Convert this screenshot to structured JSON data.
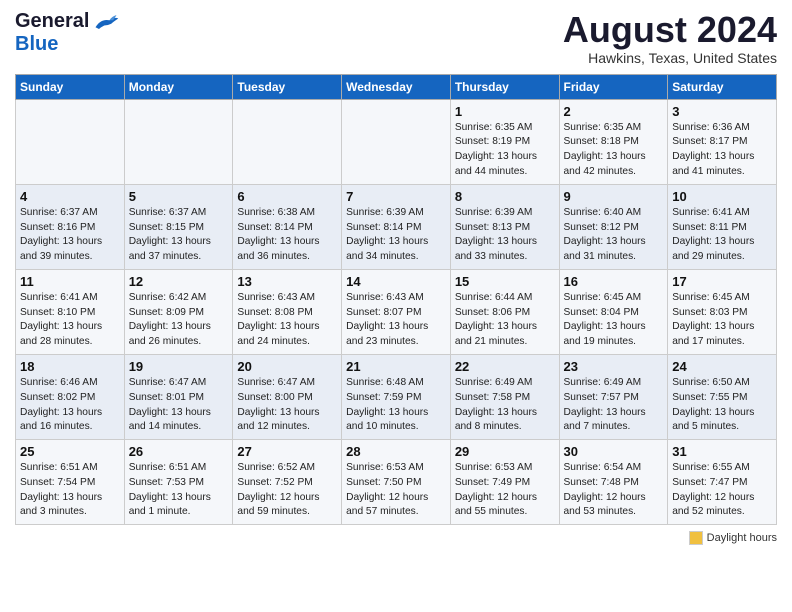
{
  "header": {
    "logo_general": "General",
    "logo_blue": "Blue",
    "month_year": "August 2024",
    "location": "Hawkins, Texas, United States"
  },
  "weekdays": [
    "Sunday",
    "Monday",
    "Tuesday",
    "Wednesday",
    "Thursday",
    "Friday",
    "Saturday"
  ],
  "weeks": [
    [
      {
        "day": "",
        "info": ""
      },
      {
        "day": "",
        "info": ""
      },
      {
        "day": "",
        "info": ""
      },
      {
        "day": "",
        "info": ""
      },
      {
        "day": "1",
        "info": "Sunrise: 6:35 AM\nSunset: 8:19 PM\nDaylight: 13 hours\nand 44 minutes."
      },
      {
        "day": "2",
        "info": "Sunrise: 6:35 AM\nSunset: 8:18 PM\nDaylight: 13 hours\nand 42 minutes."
      },
      {
        "day": "3",
        "info": "Sunrise: 6:36 AM\nSunset: 8:17 PM\nDaylight: 13 hours\nand 41 minutes."
      }
    ],
    [
      {
        "day": "4",
        "info": "Sunrise: 6:37 AM\nSunset: 8:16 PM\nDaylight: 13 hours\nand 39 minutes."
      },
      {
        "day": "5",
        "info": "Sunrise: 6:37 AM\nSunset: 8:15 PM\nDaylight: 13 hours\nand 37 minutes."
      },
      {
        "day": "6",
        "info": "Sunrise: 6:38 AM\nSunset: 8:14 PM\nDaylight: 13 hours\nand 36 minutes."
      },
      {
        "day": "7",
        "info": "Sunrise: 6:39 AM\nSunset: 8:14 PM\nDaylight: 13 hours\nand 34 minutes."
      },
      {
        "day": "8",
        "info": "Sunrise: 6:39 AM\nSunset: 8:13 PM\nDaylight: 13 hours\nand 33 minutes."
      },
      {
        "day": "9",
        "info": "Sunrise: 6:40 AM\nSunset: 8:12 PM\nDaylight: 13 hours\nand 31 minutes."
      },
      {
        "day": "10",
        "info": "Sunrise: 6:41 AM\nSunset: 8:11 PM\nDaylight: 13 hours\nand 29 minutes."
      }
    ],
    [
      {
        "day": "11",
        "info": "Sunrise: 6:41 AM\nSunset: 8:10 PM\nDaylight: 13 hours\nand 28 minutes."
      },
      {
        "day": "12",
        "info": "Sunrise: 6:42 AM\nSunset: 8:09 PM\nDaylight: 13 hours\nand 26 minutes."
      },
      {
        "day": "13",
        "info": "Sunrise: 6:43 AM\nSunset: 8:08 PM\nDaylight: 13 hours\nand 24 minutes."
      },
      {
        "day": "14",
        "info": "Sunrise: 6:43 AM\nSunset: 8:07 PM\nDaylight: 13 hours\nand 23 minutes."
      },
      {
        "day": "15",
        "info": "Sunrise: 6:44 AM\nSunset: 8:06 PM\nDaylight: 13 hours\nand 21 minutes."
      },
      {
        "day": "16",
        "info": "Sunrise: 6:45 AM\nSunset: 8:04 PM\nDaylight: 13 hours\nand 19 minutes."
      },
      {
        "day": "17",
        "info": "Sunrise: 6:45 AM\nSunset: 8:03 PM\nDaylight: 13 hours\nand 17 minutes."
      }
    ],
    [
      {
        "day": "18",
        "info": "Sunrise: 6:46 AM\nSunset: 8:02 PM\nDaylight: 13 hours\nand 16 minutes."
      },
      {
        "day": "19",
        "info": "Sunrise: 6:47 AM\nSunset: 8:01 PM\nDaylight: 13 hours\nand 14 minutes."
      },
      {
        "day": "20",
        "info": "Sunrise: 6:47 AM\nSunset: 8:00 PM\nDaylight: 13 hours\nand 12 minutes."
      },
      {
        "day": "21",
        "info": "Sunrise: 6:48 AM\nSunset: 7:59 PM\nDaylight: 13 hours\nand 10 minutes."
      },
      {
        "day": "22",
        "info": "Sunrise: 6:49 AM\nSunset: 7:58 PM\nDaylight: 13 hours\nand 8 minutes."
      },
      {
        "day": "23",
        "info": "Sunrise: 6:49 AM\nSunset: 7:57 PM\nDaylight: 13 hours\nand 7 minutes."
      },
      {
        "day": "24",
        "info": "Sunrise: 6:50 AM\nSunset: 7:55 PM\nDaylight: 13 hours\nand 5 minutes."
      }
    ],
    [
      {
        "day": "25",
        "info": "Sunrise: 6:51 AM\nSunset: 7:54 PM\nDaylight: 13 hours\nand 3 minutes."
      },
      {
        "day": "26",
        "info": "Sunrise: 6:51 AM\nSunset: 7:53 PM\nDaylight: 13 hours\nand 1 minute."
      },
      {
        "day": "27",
        "info": "Sunrise: 6:52 AM\nSunset: 7:52 PM\nDaylight: 12 hours\nand 59 minutes."
      },
      {
        "day": "28",
        "info": "Sunrise: 6:53 AM\nSunset: 7:50 PM\nDaylight: 12 hours\nand 57 minutes."
      },
      {
        "day": "29",
        "info": "Sunrise: 6:53 AM\nSunset: 7:49 PM\nDaylight: 12 hours\nand 55 minutes."
      },
      {
        "day": "30",
        "info": "Sunrise: 6:54 AM\nSunset: 7:48 PM\nDaylight: 12 hours\nand 53 minutes."
      },
      {
        "day": "31",
        "info": "Sunrise: 6:55 AM\nSunset: 7:47 PM\nDaylight: 12 hours\nand 52 minutes."
      }
    ]
  ],
  "legend": {
    "daylight_label": "Daylight hours",
    "daylight_color": "#f0c040"
  }
}
